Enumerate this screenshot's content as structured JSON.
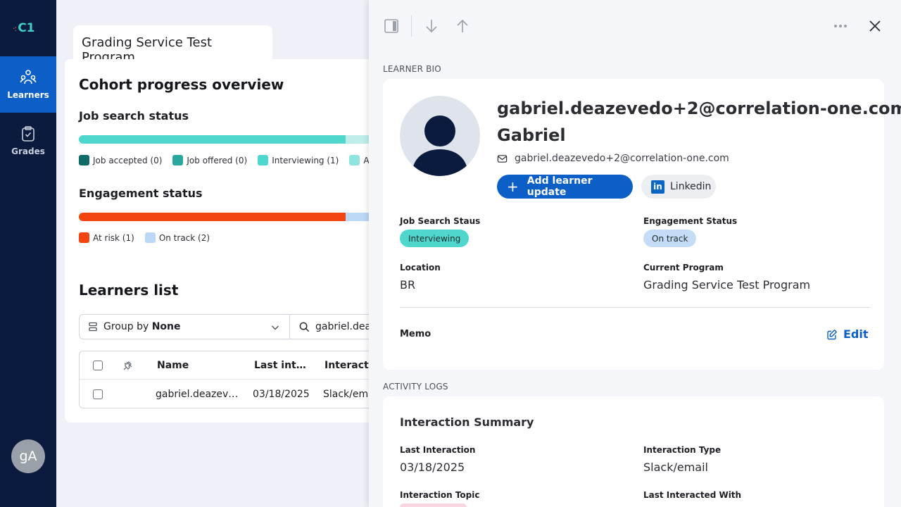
{
  "sidebar": {
    "logo_text": "C1",
    "items": [
      {
        "label": "Learners",
        "icon": "learners-icon",
        "active": true
      },
      {
        "label": "Grades",
        "icon": "clipboard-icon",
        "active": false
      }
    ],
    "avatar_initials": "gA"
  },
  "program": {
    "tab_title": "Grading Service Test Program"
  },
  "cohort": {
    "title": "Cohort progress overview",
    "job_search": {
      "title": "Job search status",
      "legend": [
        {
          "label": "Job accepted (0)",
          "color": "#0e6b66"
        },
        {
          "label": "Job offered (0)",
          "color": "#2aa79d"
        },
        {
          "label": "Interviewing (1)",
          "color": "#4fd6cd"
        },
        {
          "label": "App",
          "color": "#8ee5df"
        }
      ],
      "segments": [
        {
          "color": "#4fd6cd",
          "fraction": 0.333
        },
        {
          "color": "#bdeeea",
          "fraction": 0.667
        }
      ]
    },
    "engagement": {
      "title": "Engagement status",
      "legend": [
        {
          "label": "At risk (1)",
          "color": "#f24411"
        },
        {
          "label": "On track (2)",
          "color": "#bcd8f7"
        }
      ],
      "segments": [
        {
          "color": "#f24411",
          "fraction": 0.333
        },
        {
          "color": "#bcd8f7",
          "fraction": 0.667
        }
      ]
    }
  },
  "learners": {
    "title": "Learners list",
    "group_by_prefix": "Group by ",
    "group_by_value": "None",
    "search_value": "gabriel.deaz",
    "columns": [
      "Name",
      "Last inte...",
      "Interacti"
    ],
    "rows": [
      {
        "name": "gabriel.deazeved...",
        "last_interaction": "03/18/2025",
        "interaction": "Slack/emai"
      }
    ]
  },
  "drawer": {
    "bio_label": "LEARNER BIO",
    "email_title": "gabriel.deazevedo+2@correlation-one.com",
    "first_name": "Gabriel",
    "email": "gabriel.deazevedo+2@correlation-one.com",
    "add_update_label": "Add learner update",
    "linkedin_label": "Linkedin",
    "job_search_label": "Job Search Staus",
    "job_search_value": "Interviewing",
    "engagement_label": "Engagement Status",
    "engagement_value": "On track",
    "location_label": "Location",
    "location_value": "BR",
    "program_label": "Current Program",
    "program_value": "Grading Service Test Program",
    "memo_label": "Memo",
    "edit_label": "Edit",
    "activity_label": "ACTIVITY LOGS",
    "summary_title": "Interaction Summary",
    "last_interaction_label": "Last Interaction",
    "last_interaction_value": "03/18/2025",
    "interaction_type_label": "Interaction Type",
    "interaction_type_value": "Slack/email",
    "interaction_topic_label": "Interaction Topic",
    "last_interacted_with_label": "Last Interacted With"
  },
  "colors": {
    "sidebar_bg": "#0a1b3d",
    "accent": "#0b5fc6",
    "interviewing_pill": "#4fd6cd",
    "on_track_pill": "#c5dcf7"
  }
}
